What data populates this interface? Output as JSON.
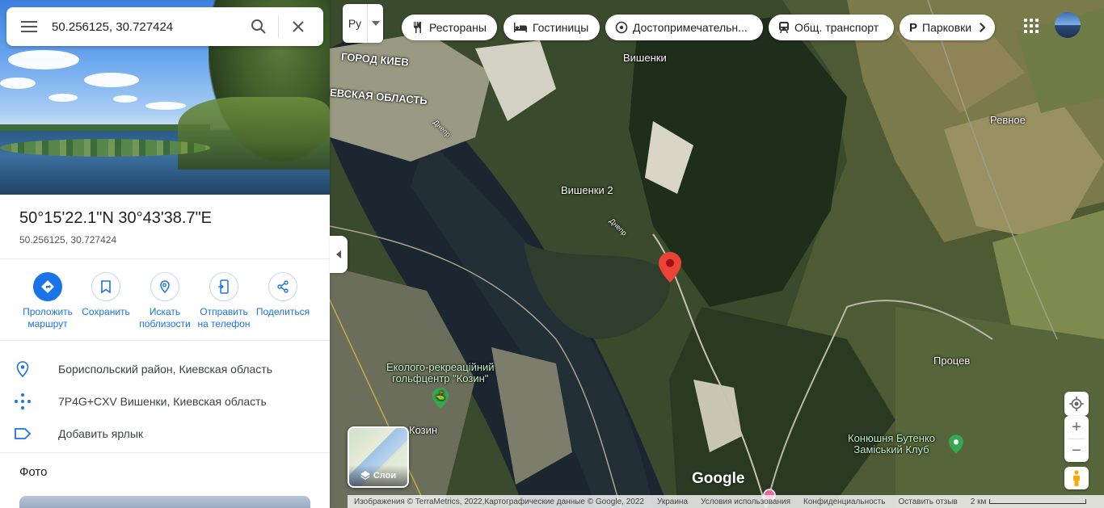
{
  "search": {
    "value": "50.256125, 30.727424"
  },
  "place": {
    "title": "50°15'22.1\"N 30°43'38.7\"E",
    "subtitle": "50.256125, 30.727424"
  },
  "actions": [
    {
      "label_1": "Проложить",
      "label_2": "маршрут",
      "icon": "directions-icon"
    },
    {
      "label_1": "Сохранить",
      "label_2": "",
      "icon": "bookmark-icon"
    },
    {
      "label_1": "Искать",
      "label_2": "поблизости",
      "icon": "nearby-icon"
    },
    {
      "label_1": "Отправить",
      "label_2": "на телефон",
      "icon": "phone-icon"
    },
    {
      "label_1": "Поделиться",
      "label_2": "",
      "icon": "share-icon"
    }
  ],
  "info": {
    "address": "Бориспольский район, Киевская область",
    "plus_code": "7P4G+CXV Вишенки, Киевская область",
    "add_label": "Добавить ярлык"
  },
  "photos_title": "Фото",
  "map": {
    "language": "Ру",
    "chips": [
      {
        "label": "Рестораны",
        "icon": "restaurant-icon"
      },
      {
        "label": "Гостиницы",
        "icon": "hotel-icon"
      },
      {
        "label": "Достопримечательн...",
        "icon": "attraction-icon"
      },
      {
        "label": "Общ. транспорт",
        "icon": "transit-icon"
      },
      {
        "label": "Парковки",
        "icon": "parking-icon"
      }
    ],
    "labels": {
      "city_kiev": "ГОРОД КИЕВ",
      "kiev_oblast": "ЕВСКАЯ ОБЛАСТЬ",
      "vishenki": "Вишенки",
      "vishenki2": "Вишенки 2",
      "revnoe": "Ревное",
      "protsev": "Процев",
      "kozin": "Козин",
      "dnepr": "Днепр",
      "golf_1": "Еколого-рекреаційний",
      "golf_2": "гольфцентр \"Козин\"",
      "stable_1": "Конюшня Бутенко",
      "stable_2": "Заміський Клуб"
    },
    "layers_label": "Слои",
    "google": "Google",
    "footer": {
      "imagery": "Изображения © TerraMetrics, 2022,Картографические данные © Google, 2022",
      "country": "Украина",
      "terms": "Условия использования",
      "privacy": "Конфиденциальность",
      "feedback": "Оставить отзыв",
      "scale": "2 км"
    }
  }
}
